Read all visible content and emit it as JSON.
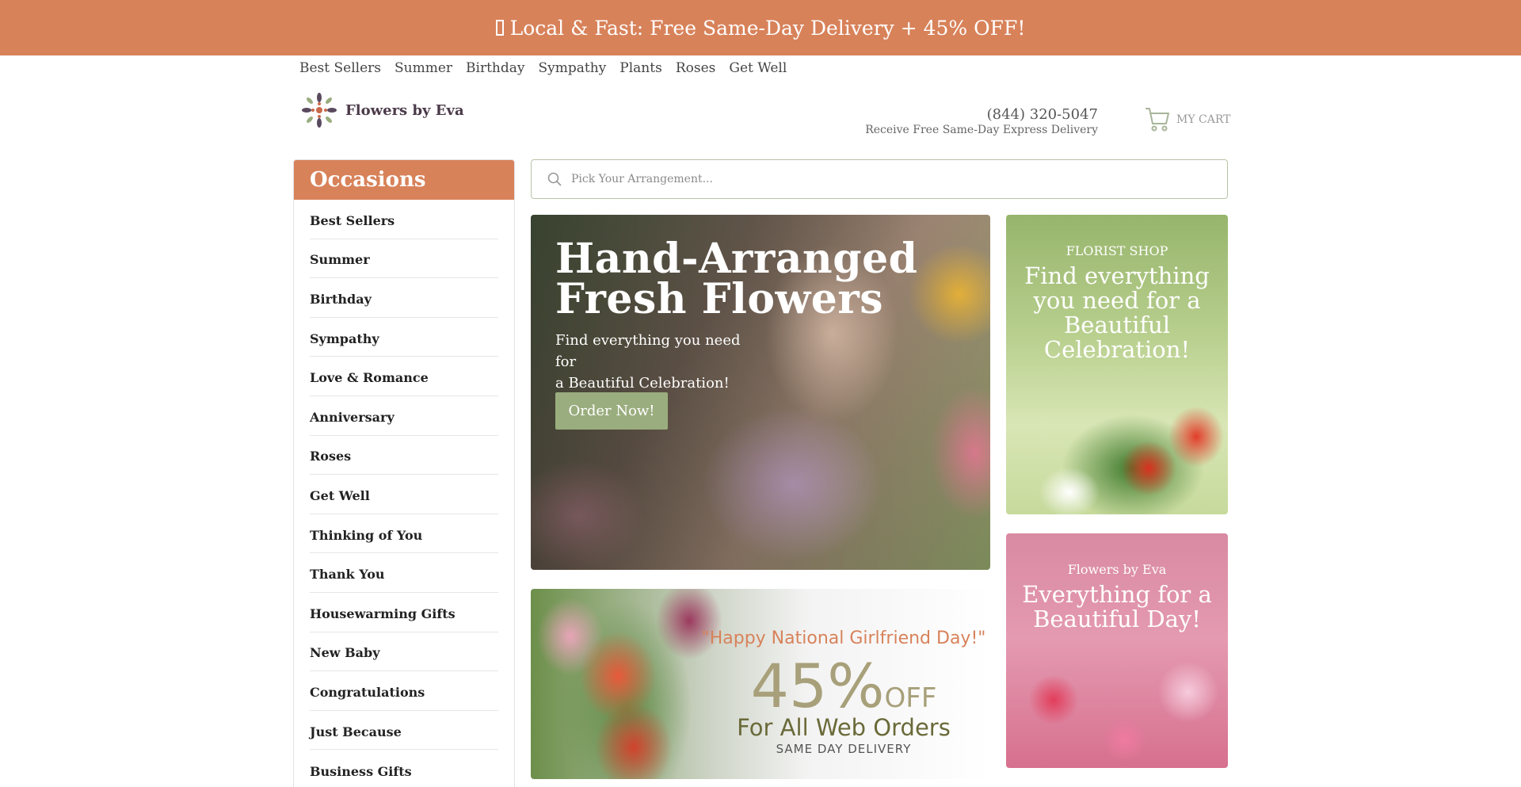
{
  "promo_bar": {
    "icon": "box-glyph-icon",
    "text": "Local & Fast: Free Same-Day Delivery + 45% OFF!"
  },
  "topnav": {
    "items": [
      "Best Sellers",
      "Summer",
      "Birthday",
      "Sympathy",
      "Plants",
      "Roses",
      "Get Well"
    ]
  },
  "logo": {
    "text": "Flowers by Eva",
    "icon": "floral-logo-icon"
  },
  "contact": {
    "phone": "(844) 320-5047",
    "subtitle": "Receive Free Same-Day Express Delivery"
  },
  "cart": {
    "label": "MY CART",
    "icon": "cart-icon"
  },
  "sidebar": {
    "title": "Occasions",
    "items": [
      "Best Sellers",
      "Summer",
      "Birthday",
      "Sympathy",
      "Love & Romance",
      "Anniversary",
      "Roses",
      "Get Well",
      "Thinking of You",
      "Thank You",
      "Housewarming Gifts",
      "New Baby",
      "Congratulations",
      "Just Because",
      "Business Gifts"
    ]
  },
  "search": {
    "placeholder": "Pick Your Arrangement...",
    "value": "",
    "icon": "search-icon"
  },
  "hero": {
    "title_line1": "Hand-Arranged",
    "title_line2": "Fresh Flowers",
    "subtitle_line1": "Find everything you need for",
    "subtitle_line2": "a Beautiful Celebration!",
    "button": "Order Now!"
  },
  "promo_banner": {
    "line1": "\"Happy National Girlfriend Day!\"",
    "percent": "45%",
    "off": "OFF",
    "line3": "For All Web Orders",
    "line4": "SAME DAY DELIVERY"
  },
  "card_shop": {
    "kicker": "FLORIST SHOP",
    "title": "Find everything you need for a Beautiful Celebration!"
  },
  "card_eva": {
    "kicker": "Flowers by Eva",
    "title": "Everything for a Beautiful Day!"
  },
  "colors": {
    "accent": "#d8825a",
    "button_green": "#9aad7e",
    "search_border": "#b9c4a7"
  }
}
